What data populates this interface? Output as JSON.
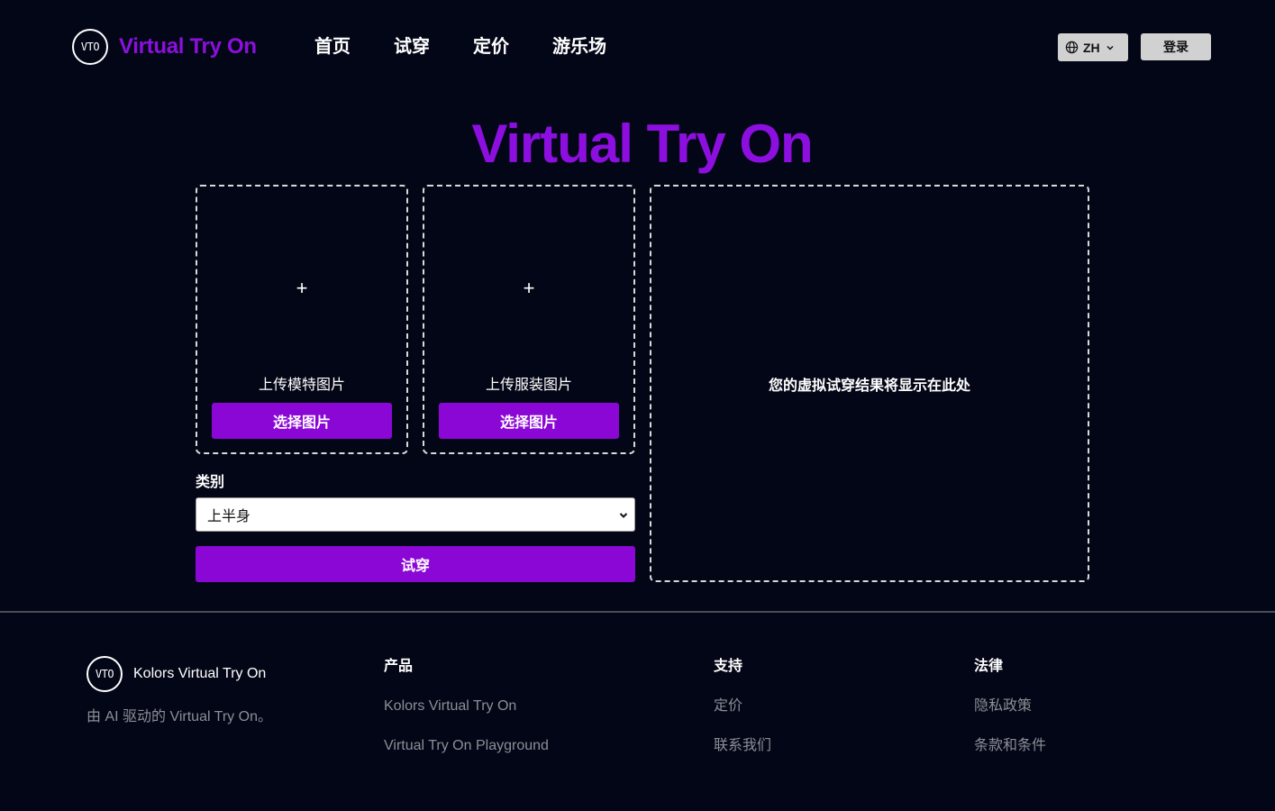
{
  "header": {
    "logo_text": "VTO",
    "brand": "Virtual Try On",
    "nav": [
      "首页",
      "试穿",
      "定价",
      "游乐场"
    ],
    "language": "ZH",
    "login_label": "登录"
  },
  "hero": {
    "title": "Virtual Try On"
  },
  "uploads": {
    "model": {
      "plus": "+",
      "label": "上传模特图片",
      "button": "选择图片"
    },
    "garment": {
      "plus": "+",
      "label": "上传服装图片",
      "button": "选择图片"
    }
  },
  "result": {
    "placeholder": "您的虚拟试穿结果将显示在此处"
  },
  "category": {
    "label": "类别",
    "selected": "上半身"
  },
  "tryon_button": "试穿",
  "footer": {
    "logo_text": "VTO",
    "brand": "Kolors Virtual Try On",
    "tagline": "由 AI 驱动的 Virtual Try On。",
    "columns": [
      {
        "title": "产品",
        "links": [
          "Kolors Virtual Try On",
          "Virtual Try On Playground"
        ]
      },
      {
        "title": "支持",
        "links": [
          "定价",
          "联系我们"
        ]
      },
      {
        "title": "法律",
        "links": [
          "隐私政策",
          "条款和条件"
        ]
      }
    ]
  },
  "colors": {
    "background": "#030616",
    "accent": "#8c0fe0",
    "button": "#8a07d6",
    "muted_text": "#8c8e97"
  }
}
